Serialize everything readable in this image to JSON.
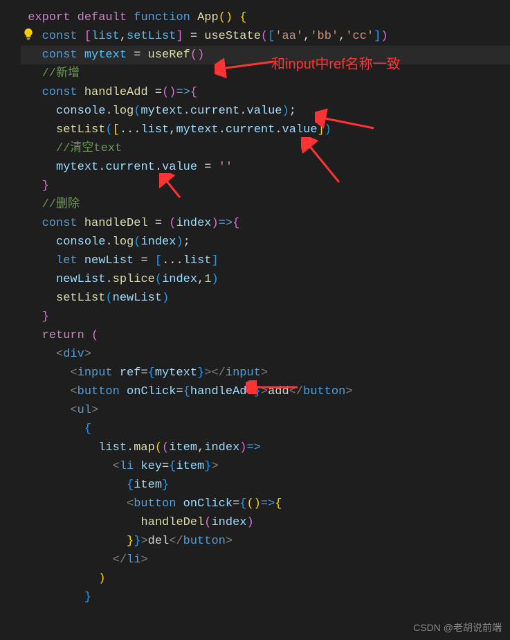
{
  "annotation": {
    "text": "和input中ref名称一致"
  },
  "watermark": "CSDN @老胡说前端",
  "code": {
    "l1": {
      "kw1": "export",
      "kw2": "default",
      "kw3": "function",
      "fn": "App",
      "p1": "()",
      "b1": "{"
    },
    "l2": {
      "kw": "const",
      "br1": "[",
      "v1": "list",
      "c1": ",",
      "v2": "setList",
      "br2": "]",
      "eq": " = ",
      "fn": "useState",
      "p1": "(",
      "br3": "[",
      "s1": "'aa'",
      "c2": ",",
      "s2": "'bb'",
      "c3": ",",
      "s3": "'cc'",
      "br4": "]",
      "p2": ")"
    },
    "l3": {
      "kw": "const",
      "v1": "mytext",
      "eq": " = ",
      "fn": "useRef",
      "p1": "(",
      "p2": ")"
    },
    "l4": {
      "comment": "//新增"
    },
    "l5": {
      "kw": "const",
      "fn": "handleAdd",
      "eq": " =",
      "p1": "()",
      "ar": "=>",
      "b1": "{"
    },
    "l6": {
      "v1": "console",
      "d1": ".",
      "fn": "log",
      "p1": "(",
      "v2": "mytext",
      "d2": ".",
      "p2": "current",
      "d3": ".",
      "p3": "value",
      "pc": ")",
      "sc": ";"
    },
    "l7": {
      "fn": "setList",
      "p1": "(",
      "br1": "[",
      "sp": "...",
      "v1": "list",
      "c1": ",",
      "v2": "mytext",
      "d1": ".",
      "pr1": "current",
      "d2": ".",
      "pr2": "value",
      "br2": "]",
      "p2": ")"
    },
    "l8": {
      "comment": "//清空text"
    },
    "l9": {
      "v1": "mytext",
      "d1": ".",
      "pr1": "current",
      "d2": ".",
      "pr2": "value",
      "eq": " = ",
      "s1": "''"
    },
    "l10": {
      "b1": "}"
    },
    "l11": {
      "comment": "//删除"
    },
    "l12": {
      "kw": "const",
      "fn": "handleDel",
      "eq": " = ",
      "p1": "(",
      "v1": "index",
      "p2": ")",
      "ar": "=>",
      "b1": "{"
    },
    "l13": {
      "v1": "console",
      "d1": ".",
      "fn": "log",
      "p1": "(",
      "v2": "index",
      "p2": ")",
      "sc": ";"
    },
    "l14": {
      "kw": "let",
      "v1": "newList",
      "eq": " = ",
      "br1": "[",
      "sp": "...",
      "v2": "list",
      "br2": "]"
    },
    "l15": {
      "v1": "newList",
      "d1": ".",
      "fn": "splice",
      "p1": "(",
      "v2": "index",
      "c1": ",",
      "n1": "1",
      "p2": ")"
    },
    "l16": {
      "fn": "setList",
      "p1": "(",
      "v1": "newList",
      "p2": ")"
    },
    "l17": {
      "b1": "}"
    },
    "l18": {
      "kw": "return",
      "p1": "("
    },
    "l19": {
      "lt": "<",
      "tag": "div",
      "gt": ">"
    },
    "l20": {
      "lt": "<",
      "tag": "input",
      "attr": "ref",
      "eq": "=",
      "b1": "{",
      "v1": "mytext",
      "b2": "}",
      "gt": ">",
      "lt2": "</",
      "tag2": "input",
      "gt2": ">"
    },
    "l21": {
      "lt": "<",
      "tag": "button",
      "attr": "onClick",
      "eq": "=",
      "b1": "{",
      "v1": "handleAdd",
      "b2": "}",
      "gt": ">",
      "txt": "add",
      "lt2": "</",
      "tag2": "button",
      "gt2": ">"
    },
    "l22": {
      "lt": "<",
      "tag": "ul",
      "gt": ">"
    },
    "l23": {
      "b1": "{"
    },
    "l24": {
      "v1": "list",
      "d1": ".",
      "fn": "map",
      "p1": "(",
      "p2": "(",
      "v2": "item",
      "c1": ",",
      "v3": "index",
      "p3": ")",
      "ar": "=>"
    },
    "l25": {
      "lt": "<",
      "tag": "li",
      "attr": "key",
      "eq": "=",
      "b1": "{",
      "v1": "item",
      "b2": "}",
      "gt": ">"
    },
    "l26": {
      "b1": "{",
      "v1": "item",
      "b2": "}"
    },
    "l27": {
      "lt": "<",
      "tag": "button",
      "attr": "onClick",
      "eq": "=",
      "b1": "{",
      "p1": "()",
      "ar": "=>",
      "b2": "{"
    },
    "l28": {
      "fn": "handleDel",
      "p1": "(",
      "v1": "index",
      "p2": ")"
    },
    "l29": {
      "b1": "}",
      "b2": "}",
      "gt": ">",
      "txt": "del",
      "lt": "</",
      "tag": "button",
      "gt2": ">"
    },
    "l30": {
      "lt": "</",
      "tag": "li",
      "gt": ">"
    },
    "l31": {
      "p1": ")"
    },
    "l32": {
      "b1": "}"
    }
  }
}
